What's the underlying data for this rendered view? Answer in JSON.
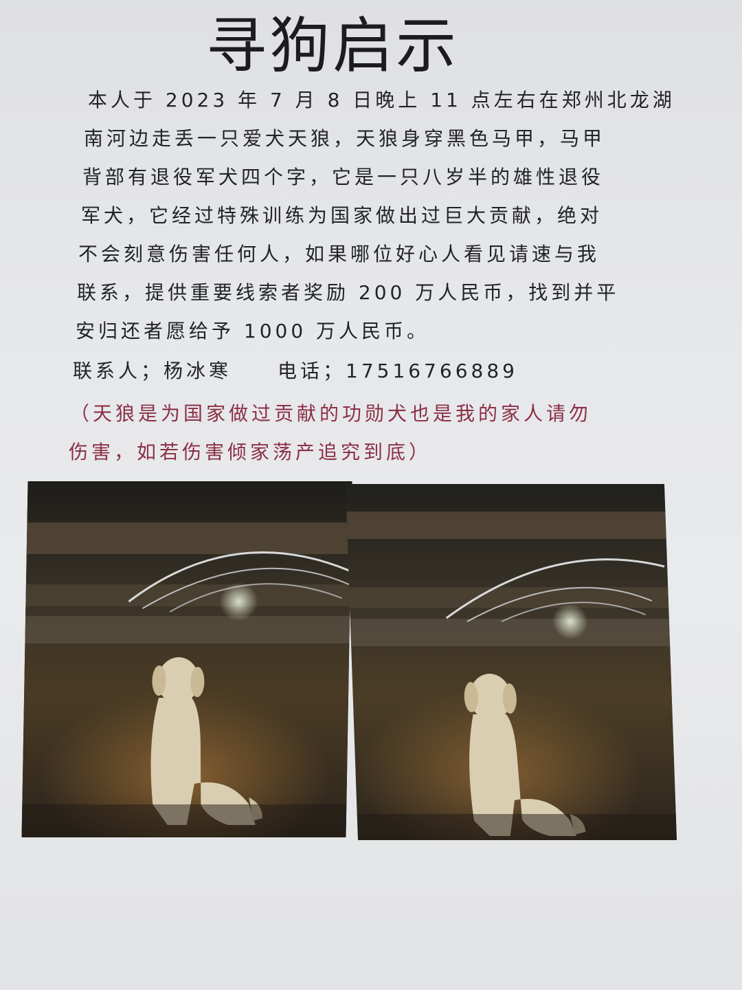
{
  "poster": {
    "title": "寻狗启示",
    "body_lines": [
      "本人于 2023 年 7 月 8 日晚上 11 点左右在郑州北龙湖",
      "南河边走丢一只爱犬天狼，天狼身穿黑色马甲，马甲",
      "背部有退役军犬四个字，它是一只八岁半的雄性退役",
      "军犬，它经过特殊训练为国家做出过巨大贡献，绝对",
      "不会刻意伤害任何人，如果哪位好心人看见请速与我",
      "联系，提供重要线索者奖励 200 万人民币，找到并平",
      "安归还者愿给予 1000 万人民币。"
    ],
    "contact": {
      "person_label": "联系人；杨冰寒",
      "phone_label": "电话；17516766889"
    },
    "note_lines": [
      "（天狼是为国家做过贡献的功勋犬也是我的家人请勿",
      "伤害，如若伤害倾家荡产追究到底）"
    ],
    "photos": [
      {
        "subject": "dog-sitting-by-river-photo-left"
      },
      {
        "subject": "dog-sitting-by-river-photo-right"
      }
    ],
    "colors": {
      "paper": "#e6e7ea",
      "text": "#222326",
      "note_text": "#8b2f45"
    }
  }
}
